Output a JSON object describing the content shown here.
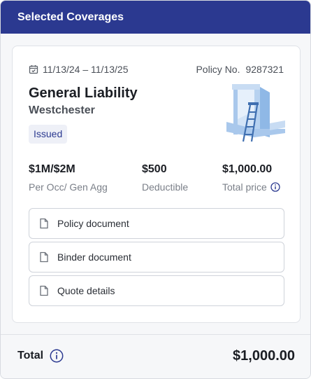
{
  "header": {
    "title": "Selected Coverages"
  },
  "policy": {
    "date_range": "11/13/24 – 11/13/25",
    "policy_no_label": "Policy No.",
    "policy_no": "9287321",
    "name": "General Liability",
    "location": "Westchester",
    "status": "Issued"
  },
  "stats": [
    {
      "value": "$1M/$2M",
      "label": "Per Occ/ Gen Agg"
    },
    {
      "value": "$500",
      "label": "Deductible"
    },
    {
      "value": "$1,000.00",
      "label": "Total price"
    }
  ],
  "documents": [
    {
      "label": "Policy document"
    },
    {
      "label": "Binder document"
    },
    {
      "label": "Quote details"
    }
  ],
  "footer": {
    "total_label": "Total",
    "total_value": "$1,000.00"
  },
  "icons": {
    "calendar": "calendar-check-icon",
    "document": "document-icon",
    "info": "info-icon"
  },
  "colors": {
    "brand": "#2b3990",
    "badge_bg": "#eef0f7",
    "illustration": "#8fb8e6"
  }
}
